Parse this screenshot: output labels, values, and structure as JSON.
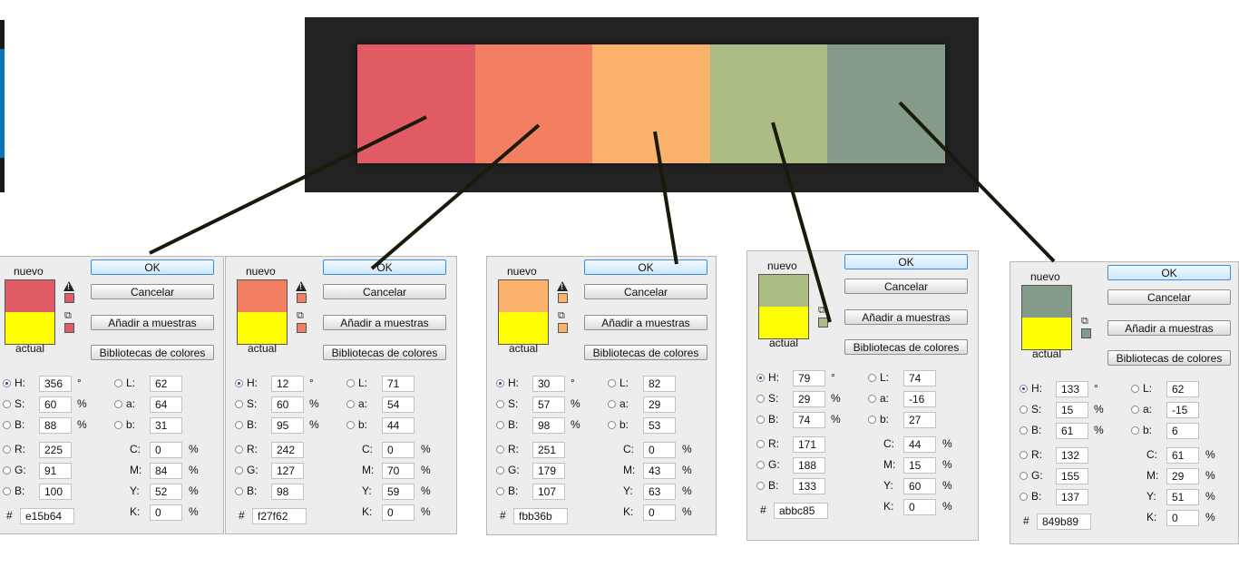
{
  "palette": [
    "#e15b64",
    "#f27f62",
    "#fbb36b",
    "#abbc85",
    "#849b89"
  ],
  "labels": {
    "nuevo": "nuevo",
    "actual": "actual",
    "ok": "OK",
    "cancel": "Cancelar",
    "add_samples": "Añadir a muestras",
    "libraries": "Bibliotecas de colores",
    "hash": "#"
  },
  "current_color": "#ffff00",
  "pickers": [
    {
      "new_color": "#e15b64",
      "H": "356",
      "S": "60",
      "B": "88",
      "L": "62",
      "a": "64",
      "b_lab": "31",
      "R": "225",
      "G": "91",
      "Bv": "100",
      "C": "0",
      "M": "84",
      "Y": "52",
      "K": "0",
      "hex": "e15b64",
      "gamut_warning": true
    },
    {
      "new_color": "#f27f62",
      "H": "12",
      "S": "60",
      "B": "95",
      "L": "71",
      "a": "54",
      "b_lab": "44",
      "R": "242",
      "G": "127",
      "Bv": "98",
      "C": "0",
      "M": "70",
      "Y": "59",
      "K": "0",
      "hex": "f27f62",
      "gamut_warning": true
    },
    {
      "new_color": "#fbb36b",
      "H": "30",
      "S": "57",
      "B": "98",
      "L": "82",
      "a": "29",
      "b_lab": "53",
      "R": "251",
      "G": "179",
      "Bv": "107",
      "C": "0",
      "M": "43",
      "Y": "63",
      "K": "0",
      "hex": "fbb36b",
      "gamut_warning": true
    },
    {
      "new_color": "#abbc85",
      "H": "79",
      "S": "29",
      "B": "74",
      "L": "74",
      "a": "-16",
      "b_lab": "27",
      "R": "171",
      "G": "188",
      "Bv": "133",
      "C": "44",
      "M": "15",
      "Y": "60",
      "K": "0",
      "hex": "abbc85",
      "gamut_warning": false
    },
    {
      "new_color": "#849b89",
      "H": "133",
      "S": "15",
      "B": "61",
      "L": "62",
      "a": "-15",
      "b_lab": "6",
      "R": "132",
      "G": "155",
      "Bv": "137",
      "C": "61",
      "M": "29",
      "Y": "51",
      "K": "0",
      "hex": "849b89",
      "gamut_warning": false
    }
  ],
  "units": {
    "degree": "°",
    "percent": "%"
  },
  "field_letters": {
    "H": "H:",
    "S": "S:",
    "B": "B:",
    "R": "R:",
    "G": "G:",
    "Bv": "B:",
    "L": "L:",
    "a": "a:",
    "b_lab": "b:",
    "C": "C:",
    "M": "M:",
    "Y": "Y:",
    "K": "K:"
  }
}
